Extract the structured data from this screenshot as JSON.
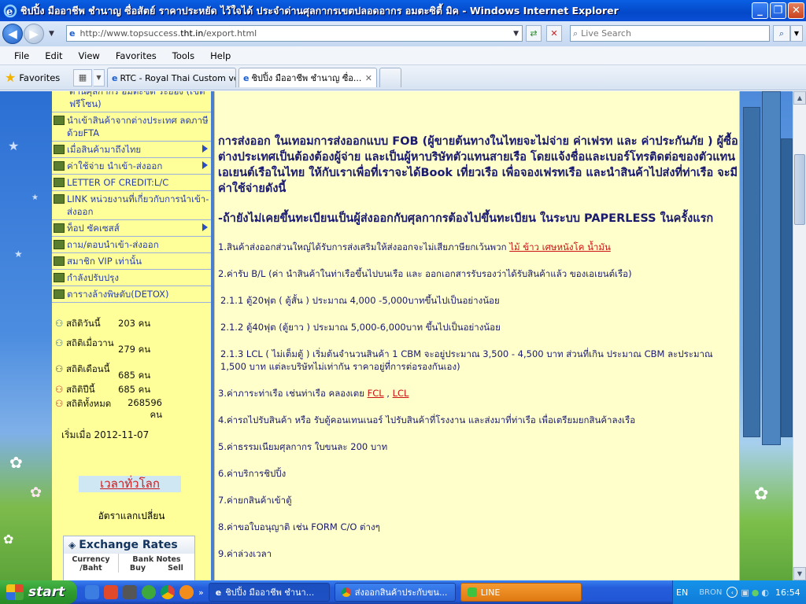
{
  "window": {
    "title": "ชิปปิ้ง มืออาชีพ ชำนาญ ซื่อสัตย์ ราคาประหยัด ไว้ใจได้ ประจำด่านศุลกากรเขตปลอดอากร อมตะซิตี้ มิค - Windows Internet Explorer"
  },
  "navbar": {
    "url_prefix": "http://www.topsuccess.",
    "url_domain": "tht.in",
    "url_suffix": "/export.html",
    "search_placeholder": "Live Search"
  },
  "menubar": {
    "items": [
      "File",
      "Edit",
      "View",
      "Favorites",
      "Tools",
      "Help"
    ]
  },
  "tabs": {
    "favorites_label": "Favorites",
    "items": [
      {
        "label": "RTC - Royal Thai Custom ver..."
      },
      {
        "label": "ชิปปิ้ง มืออาชีพ ชำนาญ ซื่อ..."
      }
    ]
  },
  "sidebar": {
    "items": [
      {
        "label": "ด่านศุลกากร อมตะซิตี้ ระยอง (เขตฟรีโซน)"
      },
      {
        "label": "นำเข้าสินค้าจากต่างประเทศ ลดภาษีด้วยFTA"
      },
      {
        "label": "เมื่อสินค้ามาถึงไทย"
      },
      {
        "label": "ค่าใช้จ่าย นำเข้า-ส่งออก"
      },
      {
        "label": "LETTER OF CREDIT:L/C"
      },
      {
        "label": "LINK หน่วยงานที่เกี่ยวกับการนำเข้า-ส่งออก"
      },
      {
        "label": "ท็อป ซัคเซสส์"
      },
      {
        "label": "ถาม/ตอบนำเข้า-ส่งออก"
      },
      {
        "label": "สมาชิก VIP เท่านั้น"
      },
      {
        "label": "กำลังปรับปรุง"
      },
      {
        "label": "ตารางล้างพิษตับ(DETOX)"
      }
    ],
    "stats": {
      "today_label": "สถิติวันนี้",
      "today_value": "203 คน",
      "yesterday_label": "สถิติเมื่อวาน",
      "yesterday_value": "279 คน",
      "month_label": "สถิติเดือนนี้",
      "month_value": "685 คน",
      "year_label": "สถิติปีนี้",
      "year_value": "685 คน",
      "total_label": "สถิติทั้งหมด",
      "total_value": "268596 คน",
      "started": "เริ่มเมื่อ 2012-11-07"
    },
    "world_time": "เวลาทั่วโลก",
    "exchange_label": "อัตราแลกเปลี่ยน",
    "exchange_box": {
      "title": "Exchange Rates",
      "col1": "Currency /Baht",
      "col2": "Bank Notes",
      "buy": "Buy",
      "sell": "Sell"
    }
  },
  "content": {
    "para1": "การส่งออก ในเทอมการส่งออกแบบ FOB (ผู้ขายต้นทางในไทยจะไม่จ่าย ค่าเฟรท และ ค่าประกันภัย ) ผู้ซื้อต่างประเทศเป็นต้องต้องผู้จ่าย และเป็นผู้หาบริษัทตัวแทนสายเรือ โดยแจ้งชื่อและเบอร์โทรติดต่อของตัวแทนเอเยนต์เรือในไทย ให้กับเราเพื่อที่เราจะได้Book เที่ยวเรือ เพื่อจองเฟรทเรือ และนำสินค้าไปส่งที่ท่าเรือ จะมีค่าใช้จ่ายดังนี้",
    "para2": "-ถ้ายังไม่เคยขึ้นทะเบียนเป็นผู้ส่งออกกับศุลกากรต้องไปขึ้นทะเบียน ในระบบ PAPERLESS ในครั้งแรก",
    "item1": "1.สินค้าส่งออกส่วนใหญ่ได้รับการส่งเสริมให้ส่งออกจะไม่เสียภาษียกเว้นพวก ",
    "item1_link": "ไม้ ข้าว เศษหนังโค น้ำมัน",
    "item2": "2.ค่ารับ B/L (ค่า นำสินค้าในท่าเรือขึ้นไปบนเรือ และ ออกเอกสารรับรองว่าได้รับสินค้าแล้ว ของเอเยนต์เรือ)",
    "item211": "2.1.1  ตู้20ฟุต ( ตู้สั้น ) ประมาณ 4,000 -5,000บาทขึ้นไปเป็นอย่างน้อย",
    "item212": "2.1.2  ตู้40ฟุต (ตู้ยาว ) ประมาณ 5,000-6,000บาท ขึ้นไปเป็นอย่างน้อย",
    "item213": "2.1.3  LCL ( ไม่เต็มตู้ ) เริ่มต้นจำนวนสินค้า 1 CBM จะอยู่ประมาณ 3,500 - 4,500 บาท ส่วนที่เกิน ประมาณ CBM ละประมาณ 1,500 บาท แต่ละบริษัทไม่เท่ากัน ราคาอยู่ที่การต่อรองกันเอง)",
    "item3": "3.ค่าภาระท่าเรือ เช่นท่าเรือ คลองเตย  ",
    "item3_link1": "FCL",
    "item3_sep": " , ",
    "item3_link2": "LCL",
    "item4": "4.ค่ารถไปรับสินค้า หรือ รับตู้คอนเทนเนอร์ ไปรับสินค้าที่โรงงาน และส่งมาที่ท่าเรือ เพื่อเตรียมยกสินค้าลงเรือ",
    "item5": "5.ค่าธรรมเนียมศุลกากร ใบขนละ 200 บาท",
    "item6": "6.ค่าบริการชิปปิ้ง",
    "item7": "7.ค่ายกสินค้าเข้าตู้",
    "item8": "8.ค่าขอใบอนุญาติ เช่น FORM C/O ต่างๆ",
    "item9": "9.ค่าล่วงเวลา"
  },
  "taskbar": {
    "start": "start",
    "tasks": [
      {
        "label": "ชิปปิ้ง มืออาชีพ ชำนา..."
      },
      {
        "label": "ส่งออกสินค้าประกับขน..."
      },
      {
        "label": "LINE"
      }
    ],
    "lang": "EN",
    "tray_text": "BRON",
    "clock": "16:54"
  },
  "colors": {
    "titlebar": "#0448c9",
    "sidebar_bg": "#ffff99",
    "content_bg": "#ffffcc",
    "link_red": "#cc1111",
    "taskbar": "#245ddb"
  }
}
